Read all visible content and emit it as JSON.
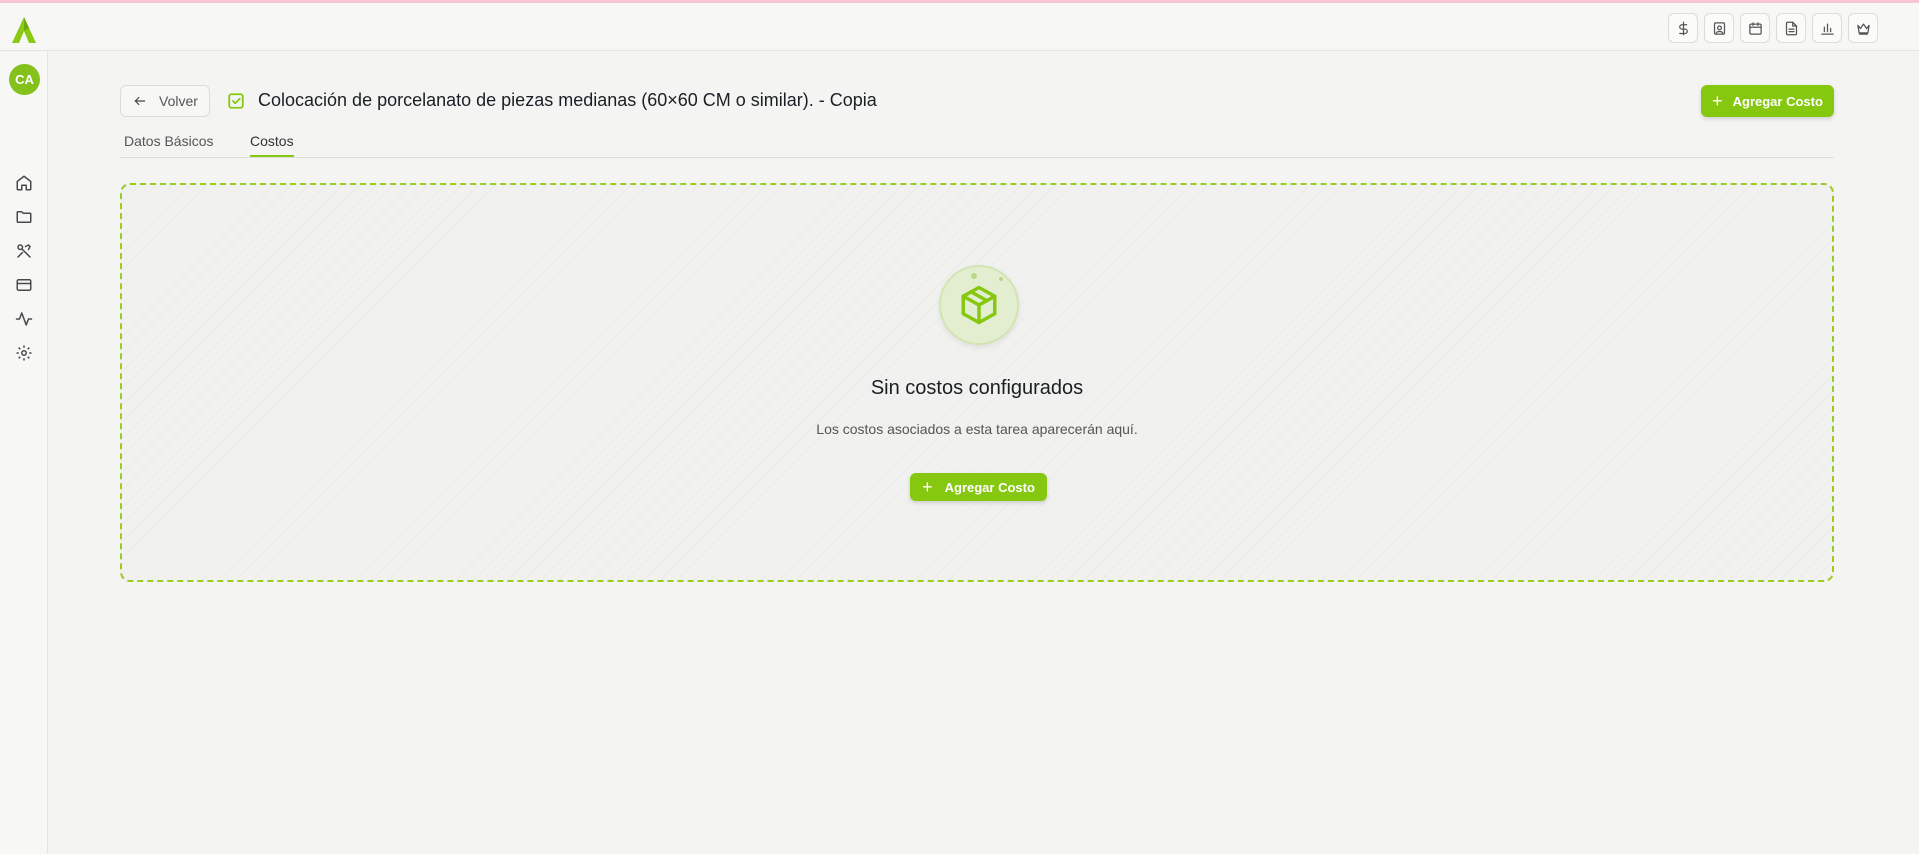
{
  "app": {
    "brand_color": "#86c70f",
    "logo_icon": "app-logo-icon"
  },
  "top_toolbar": {
    "icons": [
      "dollar-icon",
      "contact-icon",
      "calendar-icon",
      "document-icon",
      "bar-chart-icon",
      "crown-icon"
    ]
  },
  "sidebar": {
    "avatar_initials": "CA",
    "items": [
      "home-icon",
      "folder-icon",
      "tools-icon",
      "card-icon",
      "activity-icon",
      "settings-icon"
    ]
  },
  "header": {
    "back_label": "Volver",
    "title": "Colocación de porcelanato de piezas medianas (60×60 CM o similar). - Copia",
    "add_button_label": "Agregar Costo"
  },
  "tabs": [
    {
      "label": "Datos Básicos",
      "active": false
    },
    {
      "label": "Costos",
      "active": true
    }
  ],
  "empty_state": {
    "icon": "package-icon",
    "title": "Sin costos configurados",
    "description": "Los costos asociados a esta tarea aparecerán aquí.",
    "button_label": "Agregar Costo"
  }
}
